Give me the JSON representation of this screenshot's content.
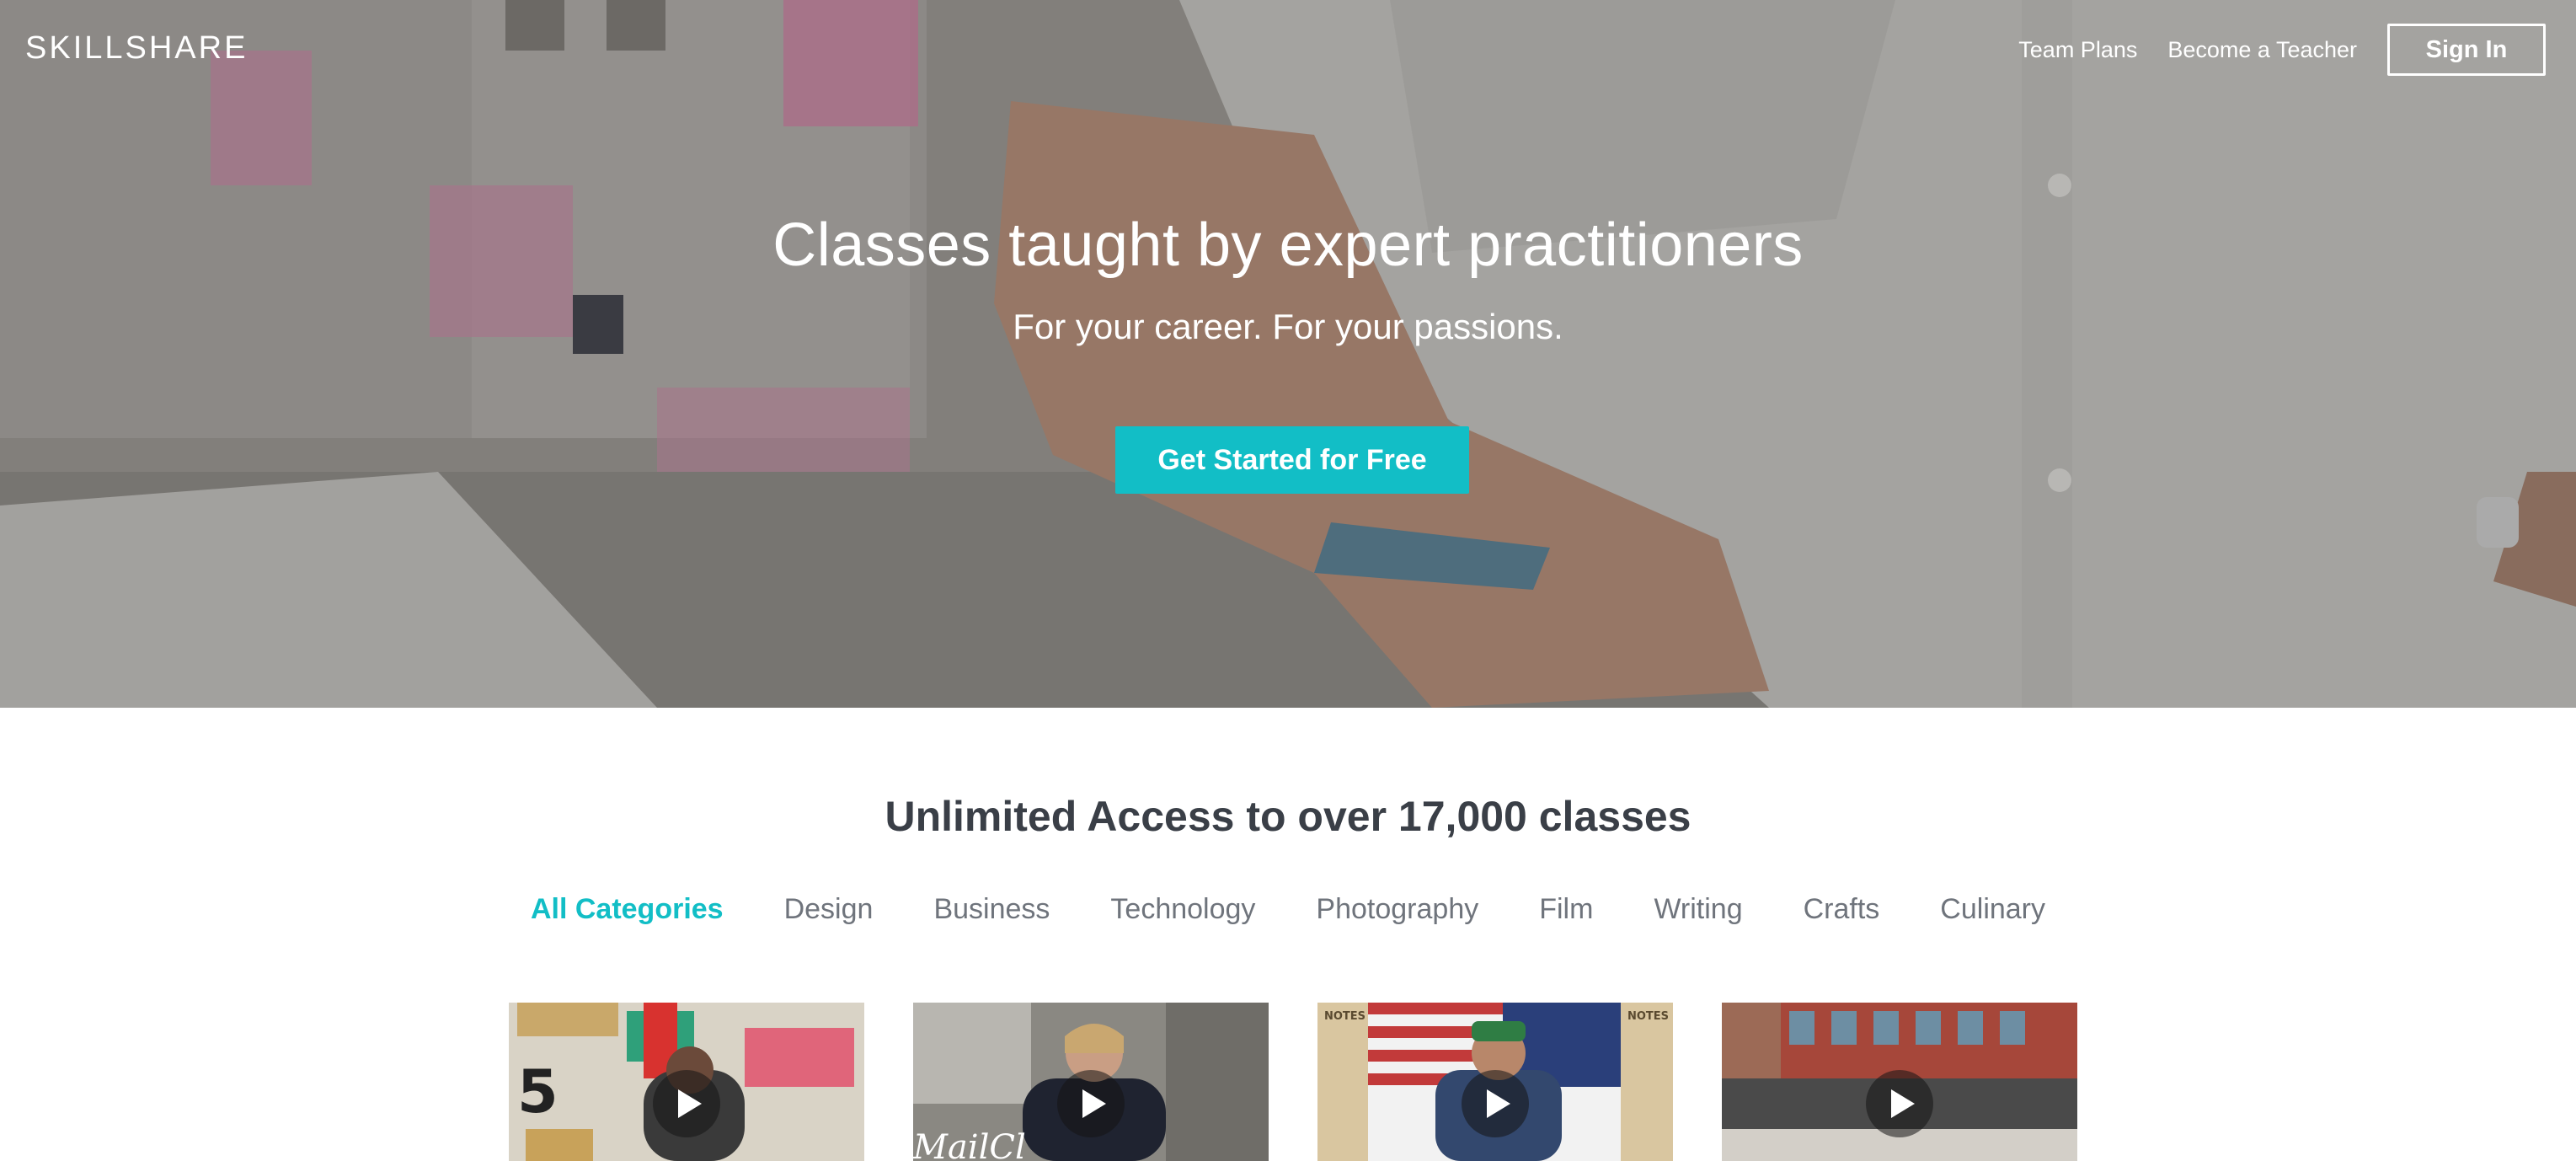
{
  "brand": {
    "logo_text": "SKILLSHARE",
    "accent": "#12bec6"
  },
  "nav": {
    "team_plans": "Team Plans",
    "become_teacher": "Become a Teacher",
    "sign_in": "Sign In"
  },
  "hero": {
    "title": "Classes taught by expert practitioners",
    "subtitle": "For your career. For your passions.",
    "cta": "Get Started for Free"
  },
  "catalog": {
    "heading": "Unlimited Access to over 17,000 classes",
    "categories": [
      {
        "label": "All Categories",
        "active": true
      },
      {
        "label": "Design",
        "active": false
      },
      {
        "label": "Business",
        "active": false
      },
      {
        "label": "Technology",
        "active": false
      },
      {
        "label": "Photography",
        "active": false
      },
      {
        "label": "Film",
        "active": false
      },
      {
        "label": "Writing",
        "active": false
      },
      {
        "label": "Crafts",
        "active": false
      },
      {
        "label": "Culinary",
        "active": false
      }
    ]
  },
  "cards": [
    {
      "icon": "play-icon"
    },
    {
      "icon": "play-icon"
    },
    {
      "icon": "play-icon"
    },
    {
      "icon": "play-icon"
    }
  ]
}
